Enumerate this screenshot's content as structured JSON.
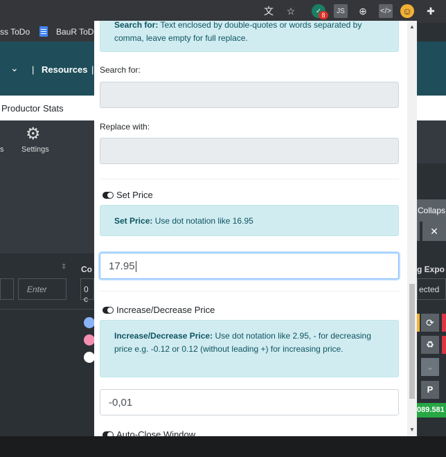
{
  "browser": {
    "bookmarks": [
      "ss ToDo",
      "BauR ToDo"
    ],
    "extension_badge": "8"
  },
  "background_app": {
    "nav_link": "Resources",
    "subnav_title": "Productor Stats",
    "toolbar_settings": "Settings",
    "toolbar_partial": "s",
    "enter_placeholder": "Enter",
    "column_partial": "Co",
    "cell_partial": "0 c",
    "right_collapse": "Collaps",
    "right_export": "g Expo",
    "right_selected": "ected",
    "right_value": "089.581"
  },
  "popup": {
    "search_info": {
      "bold": "Search for:",
      "text": " Text enclosed by double-quotes or words separated by comma, leave empty for full replace."
    },
    "search_label": "Search for:",
    "search_value": "",
    "replace_label": "Replace with:",
    "replace_value": "",
    "set_price": {
      "toggle_label": "Set Price",
      "info_bold": "Set Price:",
      "info_text": " Use dot notation like 16.95",
      "value": "17.95"
    },
    "increase_price": {
      "toggle_label": "Increase/Decrease Price",
      "info_bold": "Increase/Decrease Price:",
      "info_text": " Use dot notation like 2.95, - for decreasing price e.g. -0.12 or 0.12 (without leading +) for increasing price.",
      "value": "-0,01"
    },
    "auto_close": {
      "toggle_label": "Auto-Close Window"
    }
  }
}
